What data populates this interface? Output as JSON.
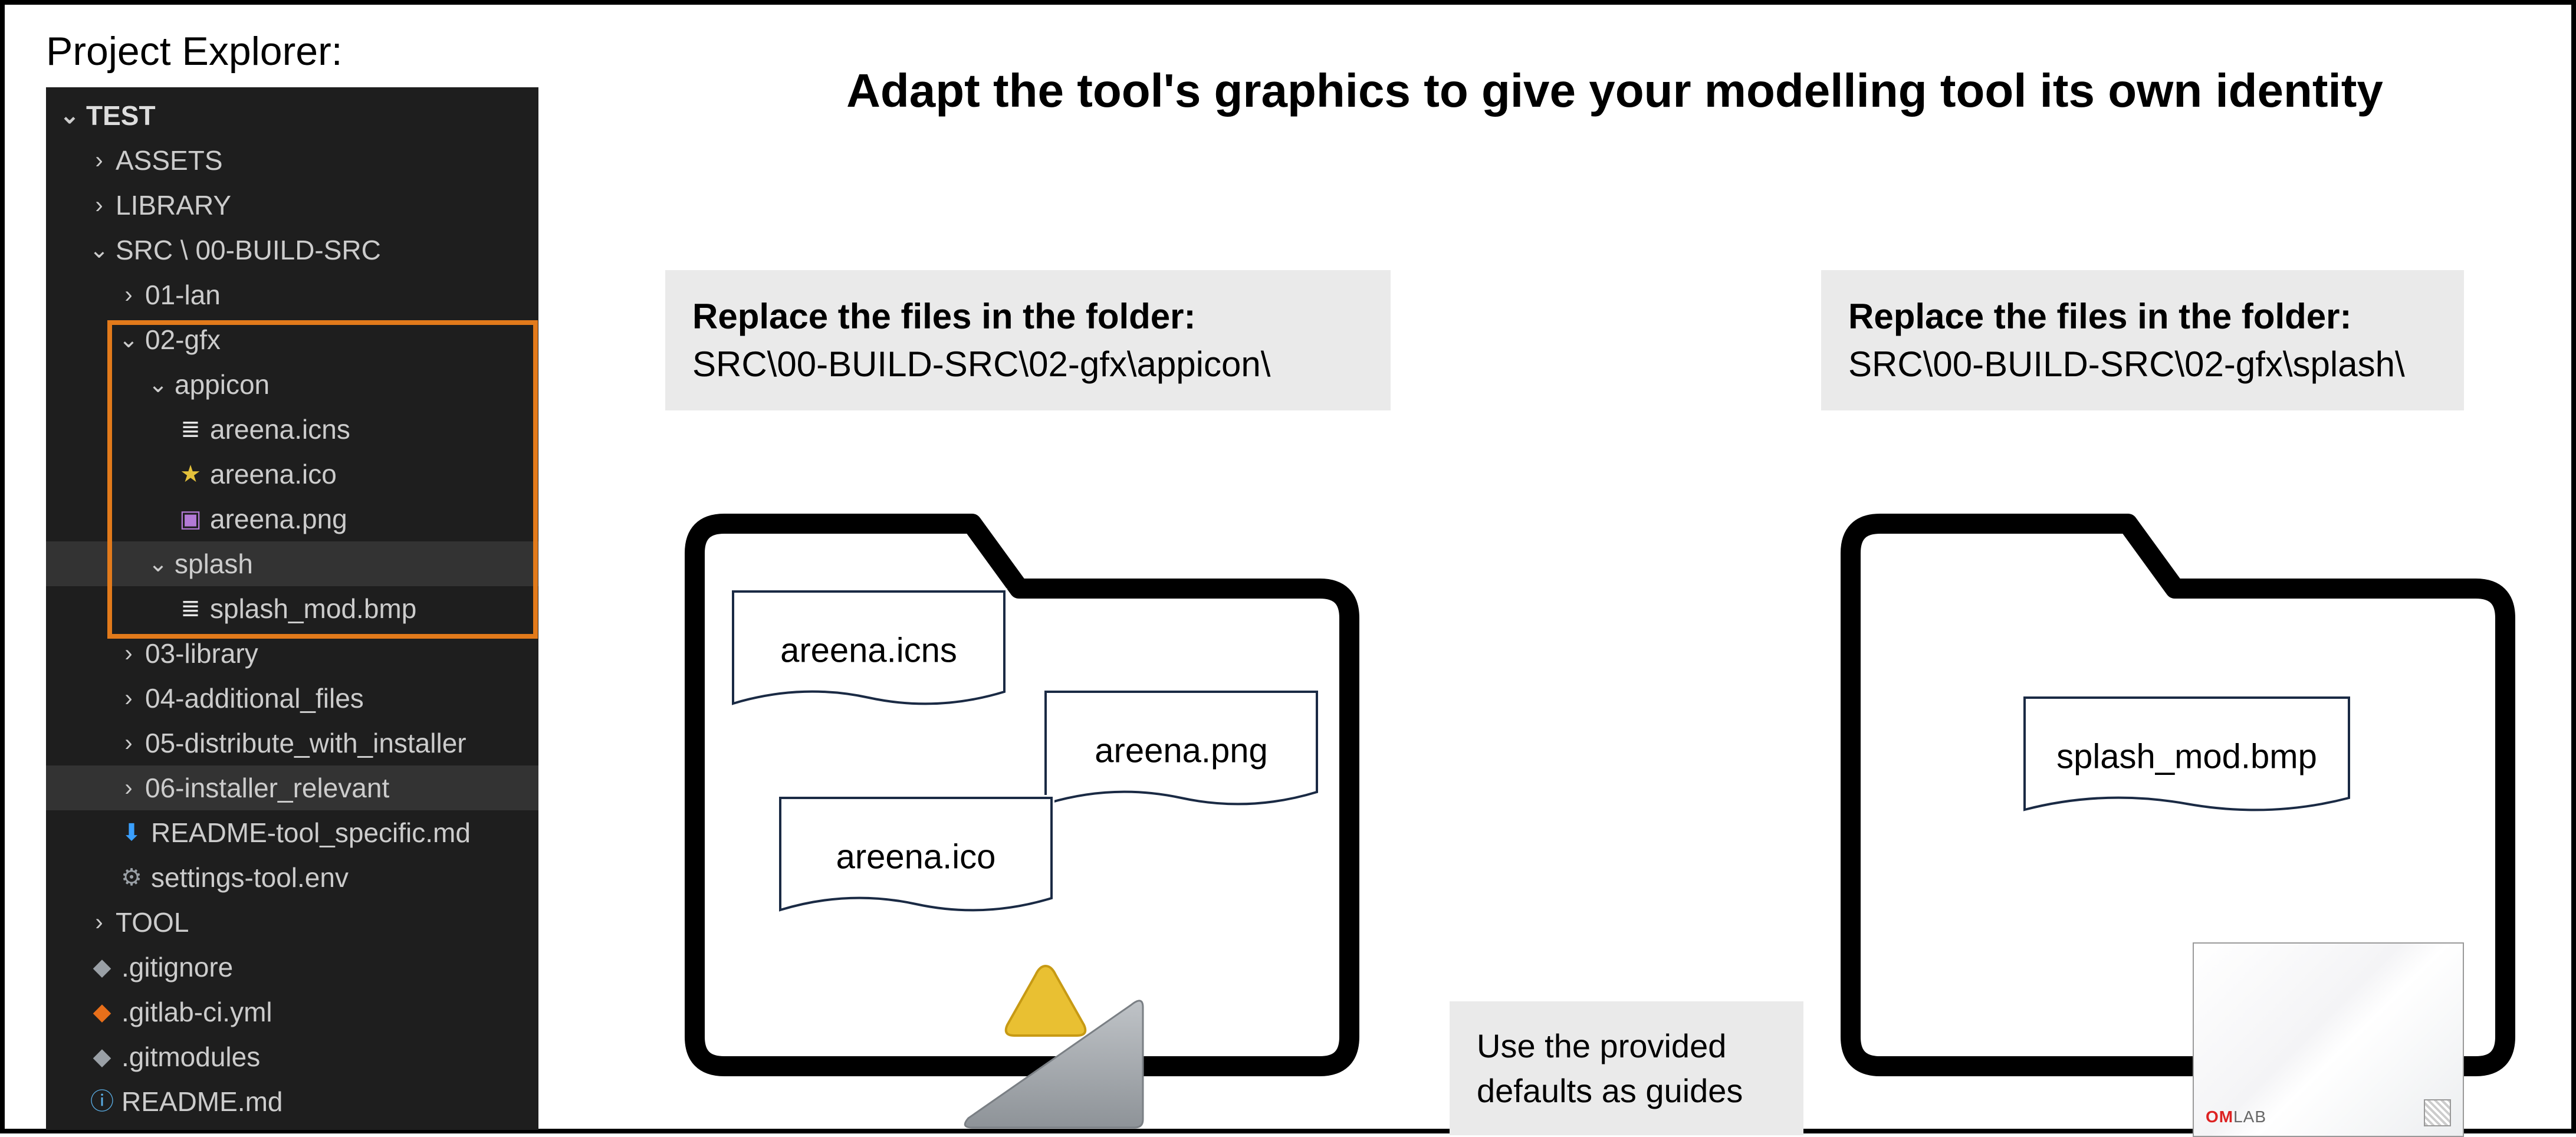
{
  "explorer": {
    "label": "Project Explorer:",
    "root": "TEST",
    "items": {
      "assets": "ASSETS",
      "library": "LIBRARY",
      "src": "SRC \\ 00-BUILD-SRC",
      "lan": "01-lan",
      "gfx": "02-gfx",
      "appicon": "appicon",
      "icns": "areena.icns",
      "ico": "areena.ico",
      "png": "areena.png",
      "splash": "splash",
      "splash_bmp": "splash_mod.bmp",
      "lib03": "03-library",
      "addl": "04-additional_files",
      "dist": "05-distribute_with_installer",
      "installer": "06-installer_relevant",
      "readme_tool": "README-tool_specific.md",
      "settings": "settings-tool.env",
      "tool": "TOOL",
      "gitignore": ".gitignore",
      "gitlabci": ".gitlab-ci.yml",
      "gitmodules": ".gitmodules",
      "readme": "README.md"
    }
  },
  "title": "Adapt the tool's graphics to give your modelling tool its own identity",
  "left_box": {
    "bold": "Replace the files in the folder:",
    "path": "SRC\\00-BUILD-SRC\\02-gfx\\appicon\\"
  },
  "right_box": {
    "bold": "Replace the files in the folder:",
    "path": "SRC\\00-BUILD-SRC\\02-gfx\\splash\\"
  },
  "hint": "Use the provided defaults as guides",
  "folder_left": {
    "files": {
      "icns": "areena.icns",
      "png": "areena.png",
      "ico": "areena.ico"
    }
  },
  "folder_right": {
    "files": {
      "bmp": "splash_mod.bmp"
    }
  },
  "splash_brand": {
    "om": "OM",
    "lab": "LAB"
  }
}
